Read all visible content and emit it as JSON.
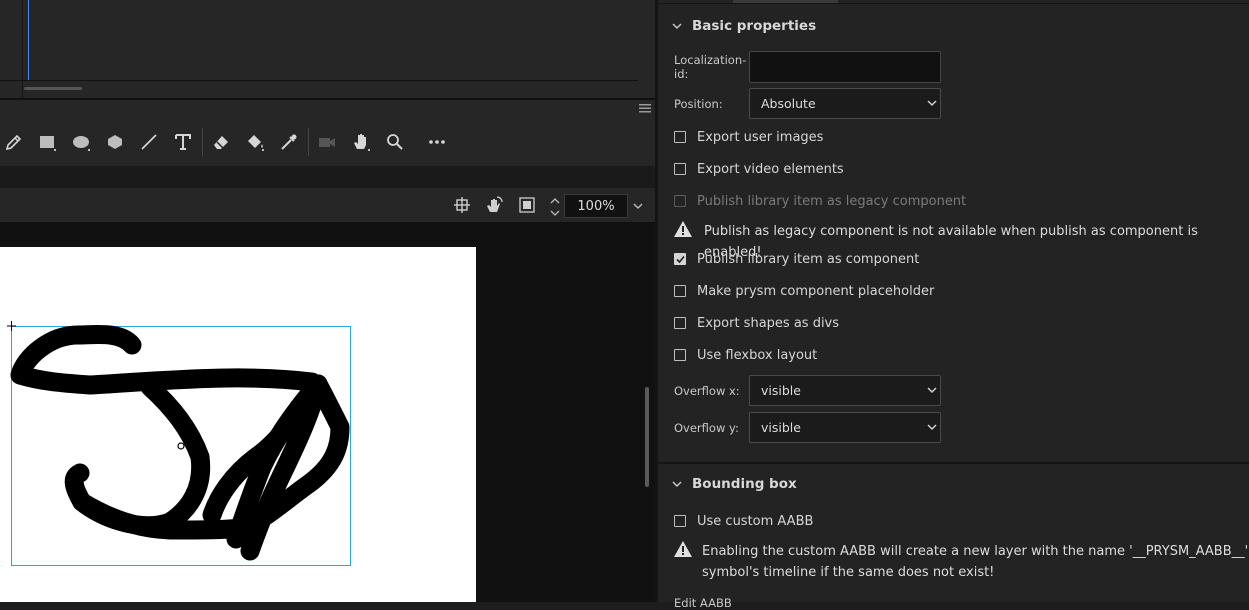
{
  "stage": {
    "zoom": "100%"
  },
  "tools": [
    {
      "name": "pencil-icon"
    },
    {
      "name": "rectangle-icon"
    },
    {
      "name": "oval-icon"
    },
    {
      "name": "polygon-icon"
    },
    {
      "name": "line-icon"
    },
    {
      "name": "text-icon"
    },
    {
      "name": "eraser-icon"
    },
    {
      "name": "paint-bucket-icon"
    },
    {
      "name": "eyedropper-icon"
    },
    {
      "name": "camera-icon"
    },
    {
      "name": "hand-icon"
    },
    {
      "name": "zoom-icon"
    },
    {
      "name": "more-icon"
    }
  ],
  "properties": {
    "basic": {
      "title": "Basic properties",
      "localization_label": "Localization-id:",
      "localization_value": "",
      "position_label": "Position:",
      "position_value": "Absolute",
      "export_user_images": "Export user images",
      "export_video_elements": "Export video elements",
      "publish_legacy": "Publish library item as legacy component",
      "legacy_warning": "Publish as legacy component is not available when publish as component is enabled!",
      "publish_component": "Publish library item as component",
      "make_placeholder": "Make prysm component placeholder",
      "export_shapes_divs": "Export shapes as divs",
      "use_flexbox": "Use flexbox layout",
      "overflow_x_label": "Overflow x:",
      "overflow_x_value": "visible",
      "overflow_y_label": "Overflow y:",
      "overflow_y_value": "visible"
    },
    "bbox": {
      "title": "Bounding box",
      "use_custom_aabb": "Use custom AABB",
      "aabb_warning_line1": "Enabling the custom AABB will create a new layer with the name '__PRYSM_AABB__' inside",
      "aabb_warning_line2": "symbol's timeline if the same does not exist!",
      "edit_aabb": "Edit AABB"
    }
  },
  "colors": {
    "accent": "#3d8ee8",
    "selection": "#2fa3dc",
    "panel": "#232323",
    "stage": "#ffffff"
  }
}
